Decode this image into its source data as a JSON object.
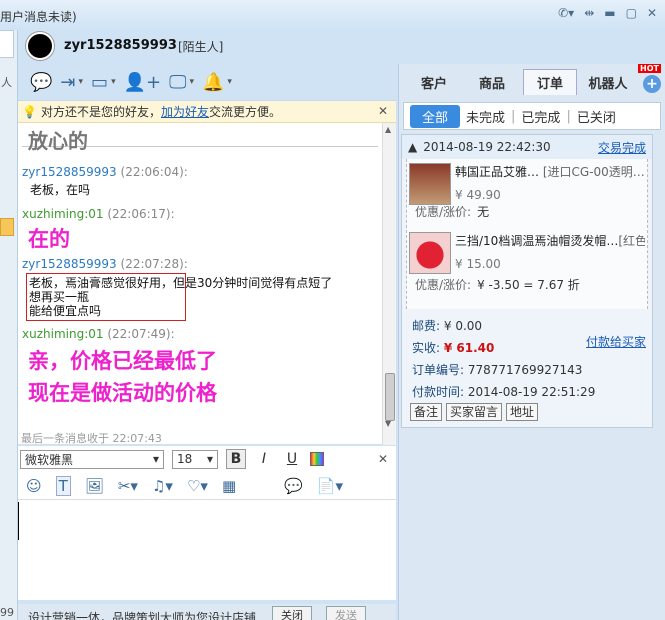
{
  "window": {
    "title": "用户消息未读)"
  },
  "header": {
    "username": "zyr1528859993",
    "status": "[陌生人]"
  },
  "left_strip": {
    "label1": "人",
    "label2": "99"
  },
  "notice": {
    "text_before": "对方还不是您的好友，",
    "link": "加为好友",
    "text_after": "交流更方便。"
  },
  "chat": {
    "prev_image_text": "放心的",
    "messages": [
      {
        "sender": "zyr1528859993",
        "time": "(22:06:04):",
        "text": "老板，在吗"
      },
      {
        "sender": "xuzhiming:01",
        "time": "(22:06:17):",
        "text": "在的"
      },
      {
        "sender": "zyr1528859993",
        "time": "(22:07:28):",
        "line1": "老板，焉油膏感觉很好用，",
        "line1_ext": "但是30分钟时间觉得有点短了",
        "line2": "想再买一瓶",
        "line3": "能给便宜点吗"
      },
      {
        "sender": "xuzhiming:01",
        "time": "(22:07:49):",
        "line1": "亲，价格已经最低了",
        "line2": "现在是做活动的价格"
      }
    ],
    "last_msg": "最后一条消息收于 22:07:43"
  },
  "fontbar": {
    "font": "微软雅黑",
    "size": "18",
    "bold": "B",
    "italic": "I",
    "underline": "U"
  },
  "footer": {
    "ad": "设计营销一体，品牌策划大师为您设计店铺",
    "close": "关闭",
    "send": "发送"
  },
  "right_panel": {
    "tabs": [
      "客户",
      "商品",
      "订单",
      "机器人"
    ],
    "hot": "HOT",
    "sub_tabs": [
      "全部",
      "未完成",
      "已完成",
      "已关闭"
    ],
    "order": {
      "date": "2014-08-19 22:42:30",
      "status": "交易完成",
      "items": [
        {
          "title": "韩国正品艾雅…",
          "spec": "[进口CG-00透明…",
          "price": "¥ 49.90",
          "disc_label": "优惠/涨价:",
          "disc_value": "无"
        },
        {
          "title": "三挡/10档调温焉油帽烫发帽…",
          "spec": "[红色]",
          "price": "¥ 15.00",
          "disc_label": "优惠/涨价:",
          "disc_value": "¥ -3.50 = 7.67 折"
        }
      ],
      "shipping_label": "邮费:",
      "shipping": "¥ 0.00",
      "paid_label": "实收:",
      "paid": "¥ 61.40",
      "pay_link": "付款给买家",
      "order_no_label": "订单编号:",
      "order_no": "778771769927143",
      "pay_time_label": "付款时间:",
      "pay_time": "2014-08-19 22:51:29",
      "buttons": [
        "备注",
        "买家留言",
        "地址"
      ]
    }
  }
}
